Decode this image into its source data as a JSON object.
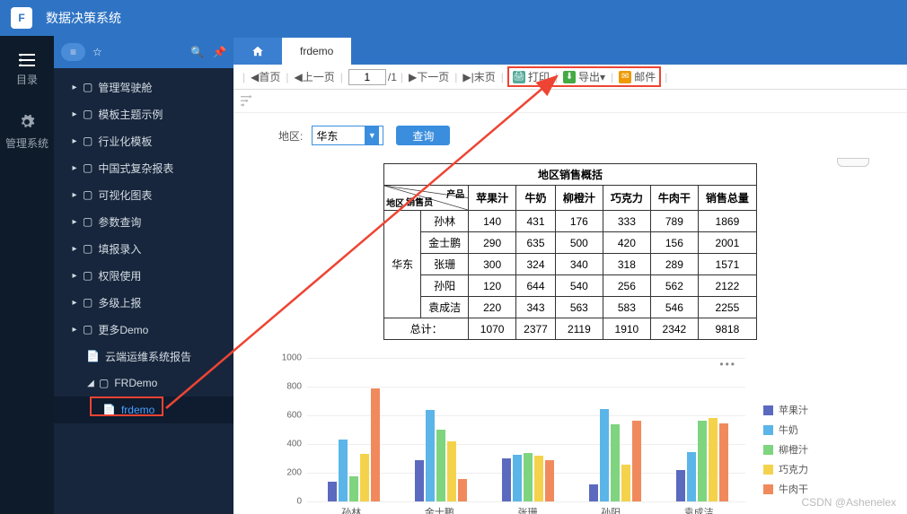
{
  "app": {
    "title": "数据决策系统"
  },
  "rail": {
    "catalog": "目录",
    "system": "管理系统"
  },
  "tree": {
    "items": [
      {
        "label": "管理驾驶舱"
      },
      {
        "label": "模板主题示例"
      },
      {
        "label": "行业化模板"
      },
      {
        "label": "中国式复杂报表"
      },
      {
        "label": "可视化图表"
      },
      {
        "label": "参数查询"
      },
      {
        "label": "填报录入"
      },
      {
        "label": "权限使用"
      },
      {
        "label": "多级上报"
      },
      {
        "label": "更多Demo"
      }
    ],
    "leaf1": "云端运维系统报告",
    "folder2": "FRDemo",
    "leaf2": "frdemo"
  },
  "tabs": {
    "active": "frdemo"
  },
  "toolbar": {
    "first": "首页",
    "prev": "上一页",
    "page": "1",
    "total": "/1",
    "next": "下一页",
    "last": "末页",
    "print": "打印",
    "export": "导出",
    "mail": "邮件"
  },
  "filter": {
    "region_label": "地区:",
    "region_value": "华东",
    "query": "查询"
  },
  "table": {
    "title": "地区销售概括",
    "diag": {
      "a": "产品",
      "b": "销售员",
      "c": "地区"
    },
    "cols": [
      "苹果汁",
      "牛奶",
      "柳橙汁",
      "巧克力",
      "牛肉干",
      "销售总量"
    ],
    "region": "华东",
    "rows": [
      {
        "name": "孙林",
        "v": [
          140,
          431,
          176,
          333,
          789,
          1869
        ]
      },
      {
        "name": "金士鹏",
        "v": [
          290,
          635,
          500,
          420,
          156,
          2001
        ]
      },
      {
        "name": "张珊",
        "v": [
          300,
          324,
          340,
          318,
          289,
          1571
        ]
      },
      {
        "name": "孙阳",
        "v": [
          120,
          644,
          540,
          256,
          562,
          2122
        ]
      },
      {
        "name": "袁成洁",
        "v": [
          220,
          343,
          563,
          583,
          546,
          2255
        ]
      }
    ],
    "total_label": "总计：",
    "totals": [
      1070,
      2377,
      2119,
      1910,
      2342,
      9818
    ]
  },
  "chart_data": {
    "type": "bar",
    "ylim": [
      0,
      1000
    ],
    "yticks": [
      0,
      200,
      400,
      600,
      800,
      1000
    ],
    "categories": [
      "孙林",
      "金士鹏",
      "张珊",
      "孙阳",
      "袁成洁"
    ],
    "series": [
      {
        "name": "苹果汁",
        "color": "#5b6abf",
        "values": [
          140,
          290,
          300,
          120,
          220
        ]
      },
      {
        "name": "牛奶",
        "color": "#5bb5e8",
        "values": [
          431,
          635,
          324,
          644,
          343
        ]
      },
      {
        "name": "柳橙汁",
        "color": "#7fd47f",
        "values": [
          176,
          500,
          340,
          540,
          563
        ]
      },
      {
        "name": "巧克力",
        "color": "#f5d24b",
        "values": [
          333,
          420,
          318,
          256,
          583
        ]
      },
      {
        "name": "牛肉干",
        "color": "#f08a5d",
        "values": [
          789,
          156,
          289,
          562,
          546
        ]
      }
    ]
  },
  "watermark": "CSDN @Ashenelex"
}
